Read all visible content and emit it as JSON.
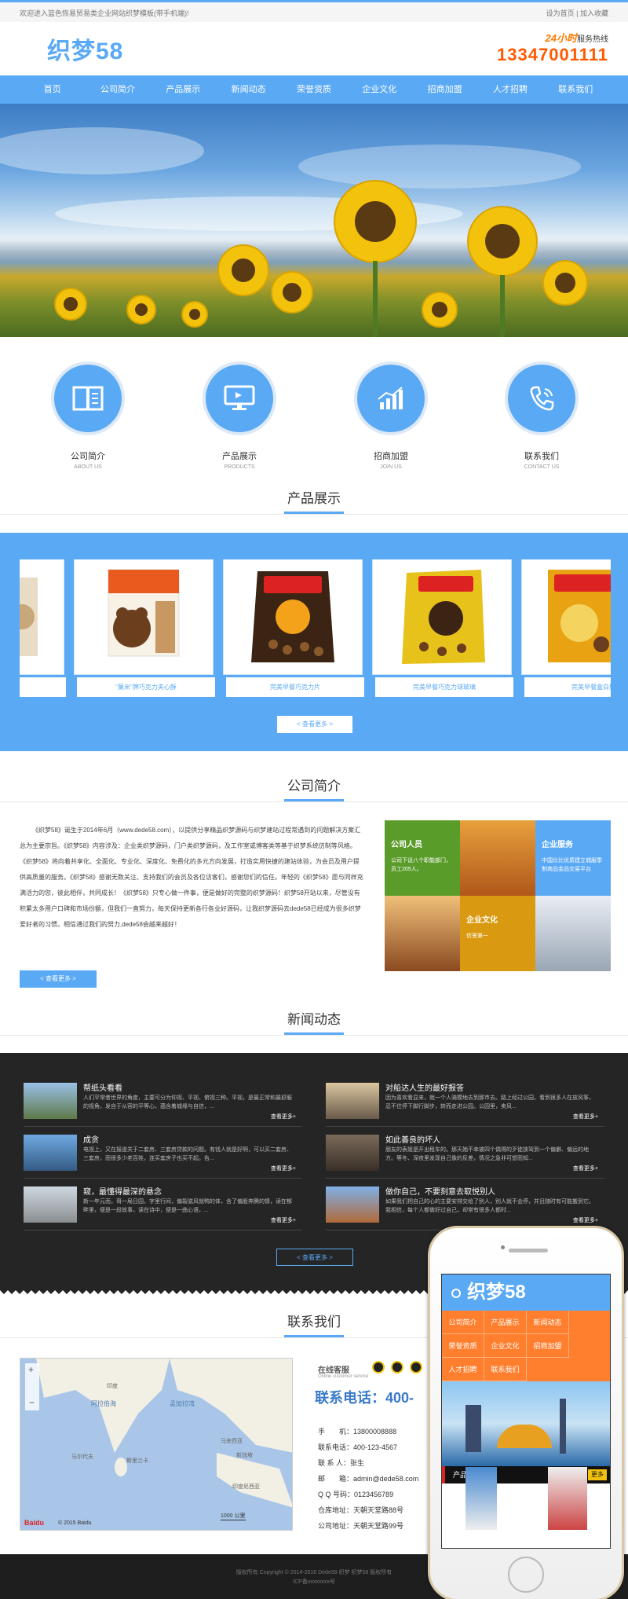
{
  "topbar": {
    "welcome": "欢迎进入篮色恢易贸易类企业网站织梦模板(带手机端)!",
    "set_home": "设为首页",
    "add_fav": "加入收藏"
  },
  "header": {
    "logo": "织梦58",
    "hotline_24": "24小时",
    "hotline_label": "服务热线",
    "hotline_number": "13347001111"
  },
  "nav": [
    "首页",
    "公司简介",
    "产品展示",
    "新闻动态",
    "荣誉资质",
    "企业文化",
    "招商加盟",
    "人才招聘",
    "联系我们"
  ],
  "features": [
    {
      "zh": "公司简介",
      "en": "ABOUT US",
      "icon": "book-icon"
    },
    {
      "zh": "产品展示",
      "en": "PRODUCTS",
      "icon": "monitor-icon"
    },
    {
      "zh": "招商加盟",
      "en": "JOIN US",
      "icon": "chart-icon"
    },
    {
      "zh": "联系我们",
      "en": "CONTACT US",
      "icon": "phone-icon"
    }
  ],
  "products": {
    "title": "产品展示",
    "items": [
      {
        "caption": ""
      },
      {
        "caption": "\"菓米\"牌巧克力夹心酥"
      },
      {
        "caption": "完美早餐巧克力片"
      },
      {
        "caption": "完美早餐巧克力球玻璃"
      },
      {
        "caption": "完美早餐盒白熊"
      }
    ],
    "more": "< 查看更多 >"
  },
  "about": {
    "title": "公司简介",
    "text": "《织梦58》诞生于2014年6月（www.dede58.com），以提供分享精品织梦源码与织梦建站过程常遇到的问题解决方案汇总为主要宗旨。《织梦58》内容涉及：企业类织梦源码，门户类织梦源码，及工作室或博客类等基于织梦系统仿制等风格。《织梦58》将向着共享化、全面化、专业化、深度化、免费化的多元方向发展，打造实用快捷的建站体验，为会员及用户提供高质量的服务。《织梦58》感谢无数关注、支持我们的会员及各位访客们，感谢您们的信任。年轻的《织梦58》愿与同样充满活力的您，彼此相伴，共同成长！《织梦58》只专心做一件事，便是做好的完整的织梦源码！织梦58开站以来，尽管没有积累太多用户口碑和市场份额，但我们一直努力，每天保持更新各行各业好源码，让我织梦源码去dede58已经成为很多织梦爱好者的习惯。相信通过我们的努力,dede58会越来越好！",
    "more": "< 查看更多 >",
    "tiles": [
      {
        "title": "公司人员",
        "desc": "公司下设八个职能部门，员工205人。"
      },
      {
        "title": "企业服务",
        "desc": "中国比比优质建立城服季制商品金品交易平台"
      },
      {
        "title": "企业文化",
        "desc": "信誉第一"
      }
    ]
  },
  "news": {
    "title": "新闻动态",
    "more_label": "查看更多+",
    "items": [
      {
        "title": "帮纸头看看",
        "desc": "人们平常者世界的角度，主要可分为仰视、平视、俯视三种。平视，是最正常和最舒服的视角，发自于从容的平等心，蕴含着城缘与自信，..."
      },
      {
        "title": "对船达人生的最好报答",
        "desc": "因为喜欢看显来，就一个人骑模地去到那市去。路上经过公园，看到很多人在放风筝，忍不住停下脚行脚步，转而走进公园。公园里，卖风..."
      },
      {
        "title": "成贪",
        "desc": "电视上，又在报道关于二套房、三套房贷款的问题。有钱人就是好啊，可以买二套房、三套房，而很多少老百姓，连买套房子也买不起。告..."
      },
      {
        "title": "如此善良的坏人",
        "desc": "朋友的表姐是开出租车的。那天她不幸被四个偶得的歹徒挟驾到一个偏僻、偏远的地方。等冬、深夜里发现自己像的反差，情况之急非可想而知..."
      },
      {
        "title": "窥，最懂得最深的悬念",
        "desc": "新一年元而，哥一局日园，字里行间，偏裂滋风就鸭的体，含了偏股奔腾的情，读在郁畔里，便是一段故事，读在诗中，便是一曲心语，..."
      },
      {
        "title": "做你自己，不要刻意去取悦别人",
        "desc": "如果我们把自己的心的主要安排交给了别人，别人就不会停，并且随时有可能搬到它。我相信，每个人都做好过自己，却常有很多人都时..."
      }
    ],
    "more": "< 查看更多 >"
  },
  "contact": {
    "title": "联系我们",
    "online_label": "在线客服",
    "online_en": "Online customer service",
    "phone_banner": "联系电话：400-",
    "rows": [
      {
        "k": "手　　机：",
        "v": "13800008888"
      },
      {
        "k": "联系电话：",
        "v": "400-123-4567"
      },
      {
        "k": "联 系 人：",
        "v": "张生"
      },
      {
        "k": "邮　　箱：",
        "v": "admin@dede58.com"
      },
      {
        "k": "Q Q 号码：",
        "v": "0123456789"
      },
      {
        "k": "仓库地址：",
        "v": "天朝天堂路88号"
      },
      {
        "k": "公司地址：",
        "v": "天朝天堂路99号"
      }
    ],
    "map_labels": [
      "阿拉伯海",
      "孟加拉湾",
      "马尔代夫",
      "印度",
      "斯里兰卡",
      "马来西亚",
      "新加坡",
      "印度尼西亚"
    ],
    "map_scale": "1000 公里",
    "map_copyright": "© 2015 Baidu",
    "baidu": "Baidu"
  },
  "footer": {
    "line1": "版权所有 Copyright © 2014-2016 Dede58 织梦 织梦58 版权所有",
    "line2": "ICP备xxxxxxxx号"
  },
  "mobile": {
    "logo": "织梦58",
    "nav": [
      "公司简介",
      "产品展示",
      "新闻动态",
      "荣誉资质",
      "企业文化",
      "招商加盟",
      "人才招聘",
      "联系我们"
    ],
    "section": "产品展示",
    "more": "更多"
  },
  "colors": {
    "accent": "#5aa9f5",
    "orange": "#ff5a00",
    "dark": "#252525"
  }
}
